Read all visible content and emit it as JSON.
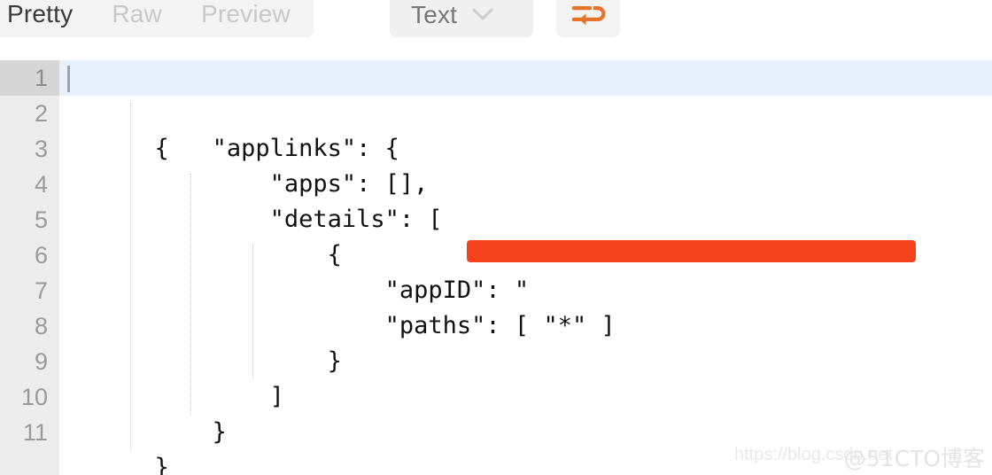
{
  "toolbar": {
    "tabs": [
      {
        "label": "Pretty",
        "active": true
      },
      {
        "label": "Raw",
        "active": false
      },
      {
        "label": "Preview",
        "active": false
      }
    ],
    "format_select": {
      "value": "Text",
      "icon": "chevron-down-icon"
    },
    "wrap_button": {
      "icon": "word-wrap-icon",
      "color": "#e8732a"
    }
  },
  "editor": {
    "active_line": 1,
    "line_numbers": [
      "1",
      "2",
      "3",
      "4",
      "5",
      "6",
      "7",
      "8",
      "9",
      "10",
      "11"
    ],
    "lines": [
      {
        "n": "1",
        "text": "{"
      },
      {
        "n": "2",
        "text": "    \"applinks\": {"
      },
      {
        "n": "3",
        "text": "        \"apps\": [],"
      },
      {
        "n": "4",
        "text": "        \"details\": ["
      },
      {
        "n": "5",
        "text": "            {"
      },
      {
        "n": "6",
        "text": "                \"appID\": \"                                \","
      },
      {
        "n": "7",
        "text": "                \"paths\": [ \"*\" ]"
      },
      {
        "n": "8",
        "text": "            }"
      },
      {
        "n": "9",
        "text": "        ]"
      },
      {
        "n": "10",
        "text": "    }"
      },
      {
        "n": "11",
        "text": "}"
      }
    ],
    "redaction": {
      "line": "6",
      "label": "redacted-appID-value",
      "color": "#f4431c"
    },
    "colors": {
      "gutter_bg": "#ececec",
      "active_line_bg": "#e6f1fb",
      "active_gutter_bg": "#d6d6d6",
      "text": "#111111",
      "line_number": "#9a9a9a"
    }
  },
  "watermark": {
    "url": "https://blog.csdn.net",
    "tag": "@51CTO博客"
  }
}
